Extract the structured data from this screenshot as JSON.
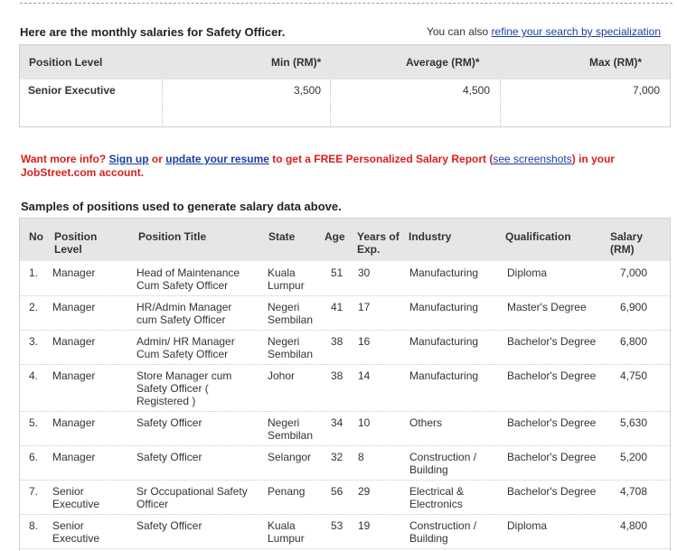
{
  "intro": {
    "title": "Here are the monthly salaries for Safety Officer.",
    "refine_prefix": "You can also",
    "refine_link": "refine your search by specialization"
  },
  "salary_table": {
    "headers": [
      "Position Level",
      "Min (RM)*",
      "Average (RM)*",
      "Max (RM)*"
    ],
    "rows": [
      {
        "level": "Senior Executive",
        "min": "3,500",
        "avg": "4,500",
        "max": "7,000"
      }
    ]
  },
  "promo": {
    "part1": "Want more info?",
    "sign_up": "Sign up",
    "part2": "or",
    "update_resume": "update your resume",
    "part3": "to get a FREE Personalized Salary Report (",
    "see_screenshots": "see screenshots",
    "part4": ") in your JobStreet.com account."
  },
  "samples": {
    "title": "Samples of positions used to generate salary data above.",
    "headers": {
      "no": "No",
      "position_level": "Position Level",
      "position_title": "Position Title",
      "state": "State",
      "age": "Age",
      "years": "Years of Exp.",
      "industry": "Industry",
      "qualification": "Qualification",
      "salary": "Salary (RM)"
    },
    "rows": [
      {
        "no": "1.",
        "level": "Manager",
        "title": "Head of Maintenance Cum Safety Officer",
        "state": "Kuala Lumpur",
        "age": "51",
        "years": "30",
        "industry": "Manufacturing",
        "qualification": "Diploma",
        "salary": "7,000"
      },
      {
        "no": "2.",
        "level": "Manager",
        "title": "HR/Admin Manager cum Safety Officer",
        "state": "Negeri Sembilan",
        "age": "41",
        "years": "17",
        "industry": "Manufacturing",
        "qualification": "Master's Degree",
        "salary": "6,900"
      },
      {
        "no": "3.",
        "level": "Manager",
        "title": "Admin/ HR Manager Cum Safety Officer",
        "state": "Negeri Sembilan",
        "age": "38",
        "years": "16",
        "industry": "Manufacturing",
        "qualification": "Bachelor's Degree",
        "salary": "6,800"
      },
      {
        "no": "4.",
        "level": "Manager",
        "title": "Store Manager cum Safety Officer ( Registered )",
        "state": "Johor",
        "age": "38",
        "years": "14",
        "industry": "Manufacturing",
        "qualification": "Bachelor's Degree",
        "salary": "4,750"
      },
      {
        "no": "5.",
        "level": "Manager",
        "title": "Safety Officer",
        "state": "Negeri Sembilan",
        "age": "34",
        "years": "10",
        "industry": "Others",
        "qualification": "Bachelor's Degree",
        "salary": "5,630"
      },
      {
        "no": "6.",
        "level": "Manager",
        "title": "Safety Officer",
        "state": "Selangor",
        "age": "32",
        "years": "8",
        "industry": "Construction / Building",
        "qualification": "Bachelor's Degree",
        "salary": "5,200"
      },
      {
        "no": "7.",
        "level": "Senior Executive",
        "title": "Sr Occupational Safety Officer",
        "state": "Penang",
        "age": "56",
        "years": "29",
        "industry": "Electrical & Electronics",
        "qualification": "Bachelor's Degree",
        "salary": "4,708"
      },
      {
        "no": "8.",
        "level": "Senior Executive",
        "title": "Safety Officer",
        "state": "Kuala Lumpur",
        "age": "53",
        "years": "19",
        "industry": "Construction / Building",
        "qualification": "Diploma",
        "salary": "4,800"
      }
    ]
  }
}
